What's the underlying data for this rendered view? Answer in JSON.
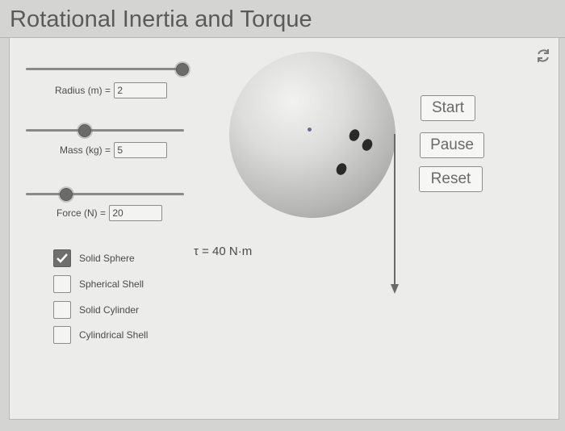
{
  "app": {
    "title": "Rotational Inertia and Torque"
  },
  "icons": {
    "reset_view": "refresh-icon",
    "checkmark": "checkmark-icon"
  },
  "sliders": {
    "radius": {
      "label": "Radius (m) = ",
      "value": "2",
      "position_fraction": 1.0
    },
    "mass": {
      "label": "Mass (kg) = ",
      "value": "5",
      "position_fraction": 0.38
    },
    "force": {
      "label": "Force (N) = ",
      "value": "20",
      "position_fraction": 0.25
    }
  },
  "buttons": {
    "start": "Start",
    "pause": "Pause",
    "reset": "Reset"
  },
  "torque": {
    "text": "τ = 40 N·m"
  },
  "shapes": [
    {
      "label": "Solid Sphere",
      "checked": true
    },
    {
      "label": "Spherical Shell",
      "checked": false
    },
    {
      "label": "Solid Cylinder",
      "checked": false
    },
    {
      "label": "Cylindrical Shell",
      "checked": false
    }
  ],
  "colors": {
    "panel": "#ececea",
    "sphere": "#c8c8c6",
    "thumb": "#6b6b6b",
    "force_arrow": "#6a6a6a"
  }
}
